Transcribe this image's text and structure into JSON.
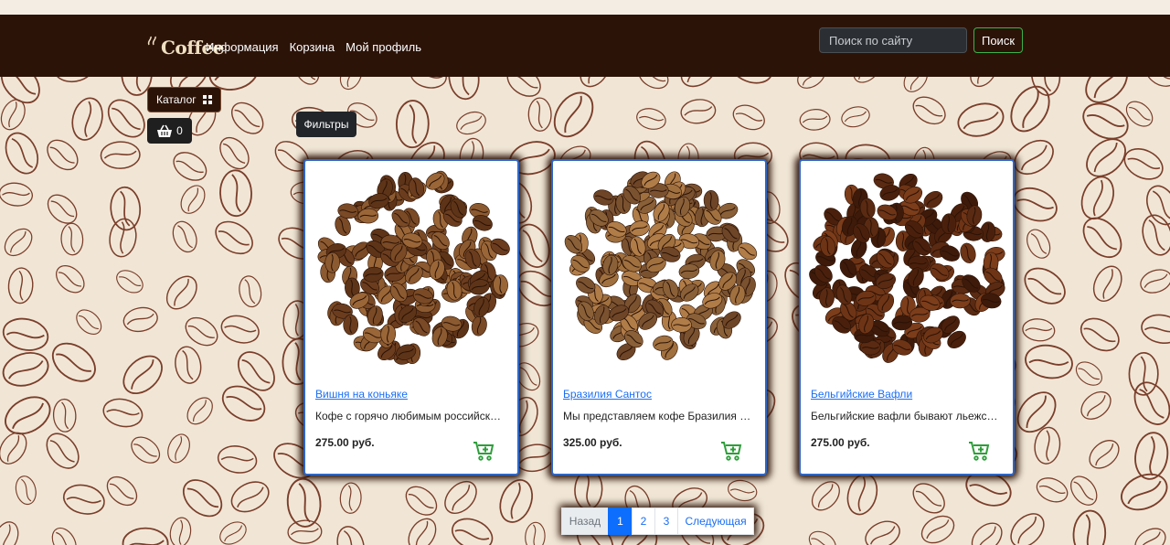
{
  "header": {
    "logo_text": "Coffee",
    "nav": [
      "Информация",
      "Корзина",
      "Мой профиль"
    ],
    "search_placeholder": "Поиск по сайту",
    "search_button": "Поиск"
  },
  "sidebar": {
    "catalog_label": "Каталог",
    "cart_count": "0",
    "filters_label": "Фильтры"
  },
  "products": [
    {
      "title": "Вишня на коньяке",
      "description": "Кофе с горячо любимым российски...",
      "price": "275.00 руб."
    },
    {
      "title": "Бразилия Сантос",
      "description": "Мы представляем кофе Бразилия Са...",
      "price": "325.00 руб."
    },
    {
      "title": "Бельгийские Вафли",
      "description": "Бельгийские вафли бывают льежски...",
      "price": "275.00 руб."
    }
  ],
  "pagination": {
    "prev": "Назад",
    "pages": [
      "1",
      "2",
      "3"
    ],
    "next": "Следующая",
    "current": "1"
  },
  "colors": {
    "navbar": "#2c1308",
    "background": "#f1e6d6",
    "link": "#1a6ef5",
    "accent_green": "#3bb34a",
    "card_border": "#2f66c6"
  },
  "icons": {
    "catalog": "grid-icon",
    "cart": "basket-icon",
    "add_to_cart": "cart-plus-icon"
  }
}
